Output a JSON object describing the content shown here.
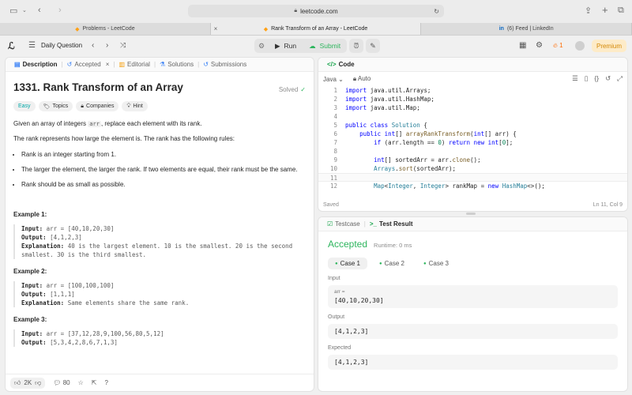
{
  "browser": {
    "url": "leetcode.com",
    "tabs": [
      {
        "label": "Problems - LeetCode"
      },
      {
        "label": "Rank Transform of an Array - LeetCode"
      },
      {
        "label": "(6) Feed | LinkedIn"
      }
    ]
  },
  "header": {
    "daily": "Daily Question",
    "run": "Run",
    "submit": "Submit",
    "streak": "1",
    "premium": "Premium"
  },
  "left_tabs": {
    "description": "Description",
    "accepted": "Accepted",
    "editorial": "Editorial",
    "solutions": "Solutions",
    "submissions": "Submissions"
  },
  "problem": {
    "title": "1331. Rank Transform of an Array",
    "solved": "Solved",
    "tags": {
      "easy": "Easy",
      "topics": "Topics",
      "companies": "Companies",
      "hint": "Hint"
    },
    "intro_a": "Given an array of integers ",
    "intro_code": "arr",
    "intro_b": ", replace each element with its rank.",
    "rank_desc": "The rank represents how large the element is. The rank has the following rules:",
    "rules": [
      "Rank is an integer starting from 1.",
      "The larger the element, the larger the rank. If two elements are equal, their rank must be the same.",
      "Rank should be as small as possible."
    ],
    "examples": [
      {
        "title": "Example 1:",
        "input": "arr = [40,10,20,30]",
        "output": "[4,1,2,3]",
        "explanation": "40 is the largest element. 10 is the smallest. 20 is the second smallest. 30 is the third smallest."
      },
      {
        "title": "Example 2:",
        "input": "arr = [100,100,100]",
        "output": "[1,1,1]",
        "explanation": "Same elements share the same rank."
      },
      {
        "title": "Example 3:",
        "input": "arr = [37,12,28,9,100,56,80,5,12]",
        "output": "[5,3,4,2,8,6,7,1,3]"
      }
    ],
    "labels": {
      "input": "Input:",
      "output": "Output:",
      "explanation": "Explanation:"
    },
    "likes": "2K",
    "comments": "80"
  },
  "code": {
    "title": "Code",
    "language": "Java",
    "auto": "Auto",
    "status_left": "Saved",
    "status_right": "Ln 11, Col 9"
  },
  "result": {
    "testcase_tab": "Testcase",
    "result_tab": "Test Result",
    "status": "Accepted",
    "runtime": "Runtime: 0 ms",
    "cases": [
      "Case 1",
      "Case 2",
      "Case 3"
    ],
    "input_label": "Input",
    "input_var": "arr =",
    "input_value": "[40,10,20,30]",
    "output_label": "Output",
    "output_value": "[4,1,2,3]",
    "expected_label": "Expected",
    "expected_value": "[4,1,2,3]"
  }
}
